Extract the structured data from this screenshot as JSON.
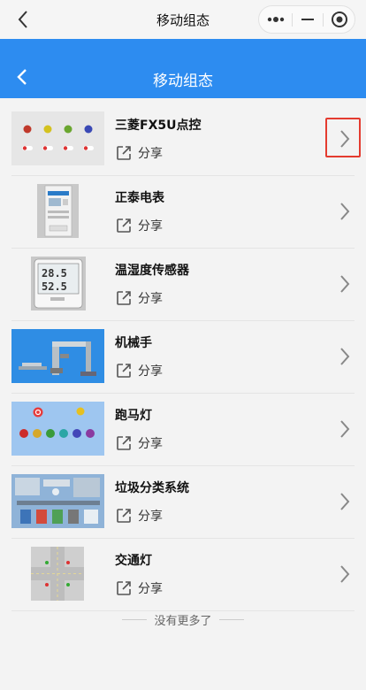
{
  "wx_bar": {
    "title": "移动组态",
    "icons": [
      "back-arrow-icon",
      "more-dots-icon",
      "minimize-icon",
      "target-close-icon"
    ]
  },
  "header": {
    "title": "移动组态",
    "back_icon": "back-arrow-icon"
  },
  "items": [
    {
      "title": "三菱FX5U点控",
      "share_label": "分享",
      "thumb": "colored-indicator-lamps"
    },
    {
      "title": "正泰电表",
      "share_label": "分享",
      "thumb": "din-rail-meter"
    },
    {
      "title": "温湿度传感器",
      "share_label": "分享",
      "thumb": "temp-humidity-display"
    },
    {
      "title": "机械手",
      "share_label": "分享",
      "thumb": "robot-arm"
    },
    {
      "title": "跑马灯",
      "share_label": "分享",
      "thumb": "marquee-lights"
    },
    {
      "title": "垃圾分类系统",
      "share_label": "分享",
      "thumb": "sorting-system-diagram"
    },
    {
      "title": "交通灯",
      "share_label": "分享",
      "thumb": "traffic-intersection"
    }
  ],
  "thumb_text": {
    "temp": "28.5",
    "humidity": "52.5"
  },
  "footer": {
    "note": "没有更多了"
  },
  "colors": {
    "header_blue": "#2d8cf0",
    "highlight_red": "#e43b2f",
    "background": "#f3f3f3"
  }
}
